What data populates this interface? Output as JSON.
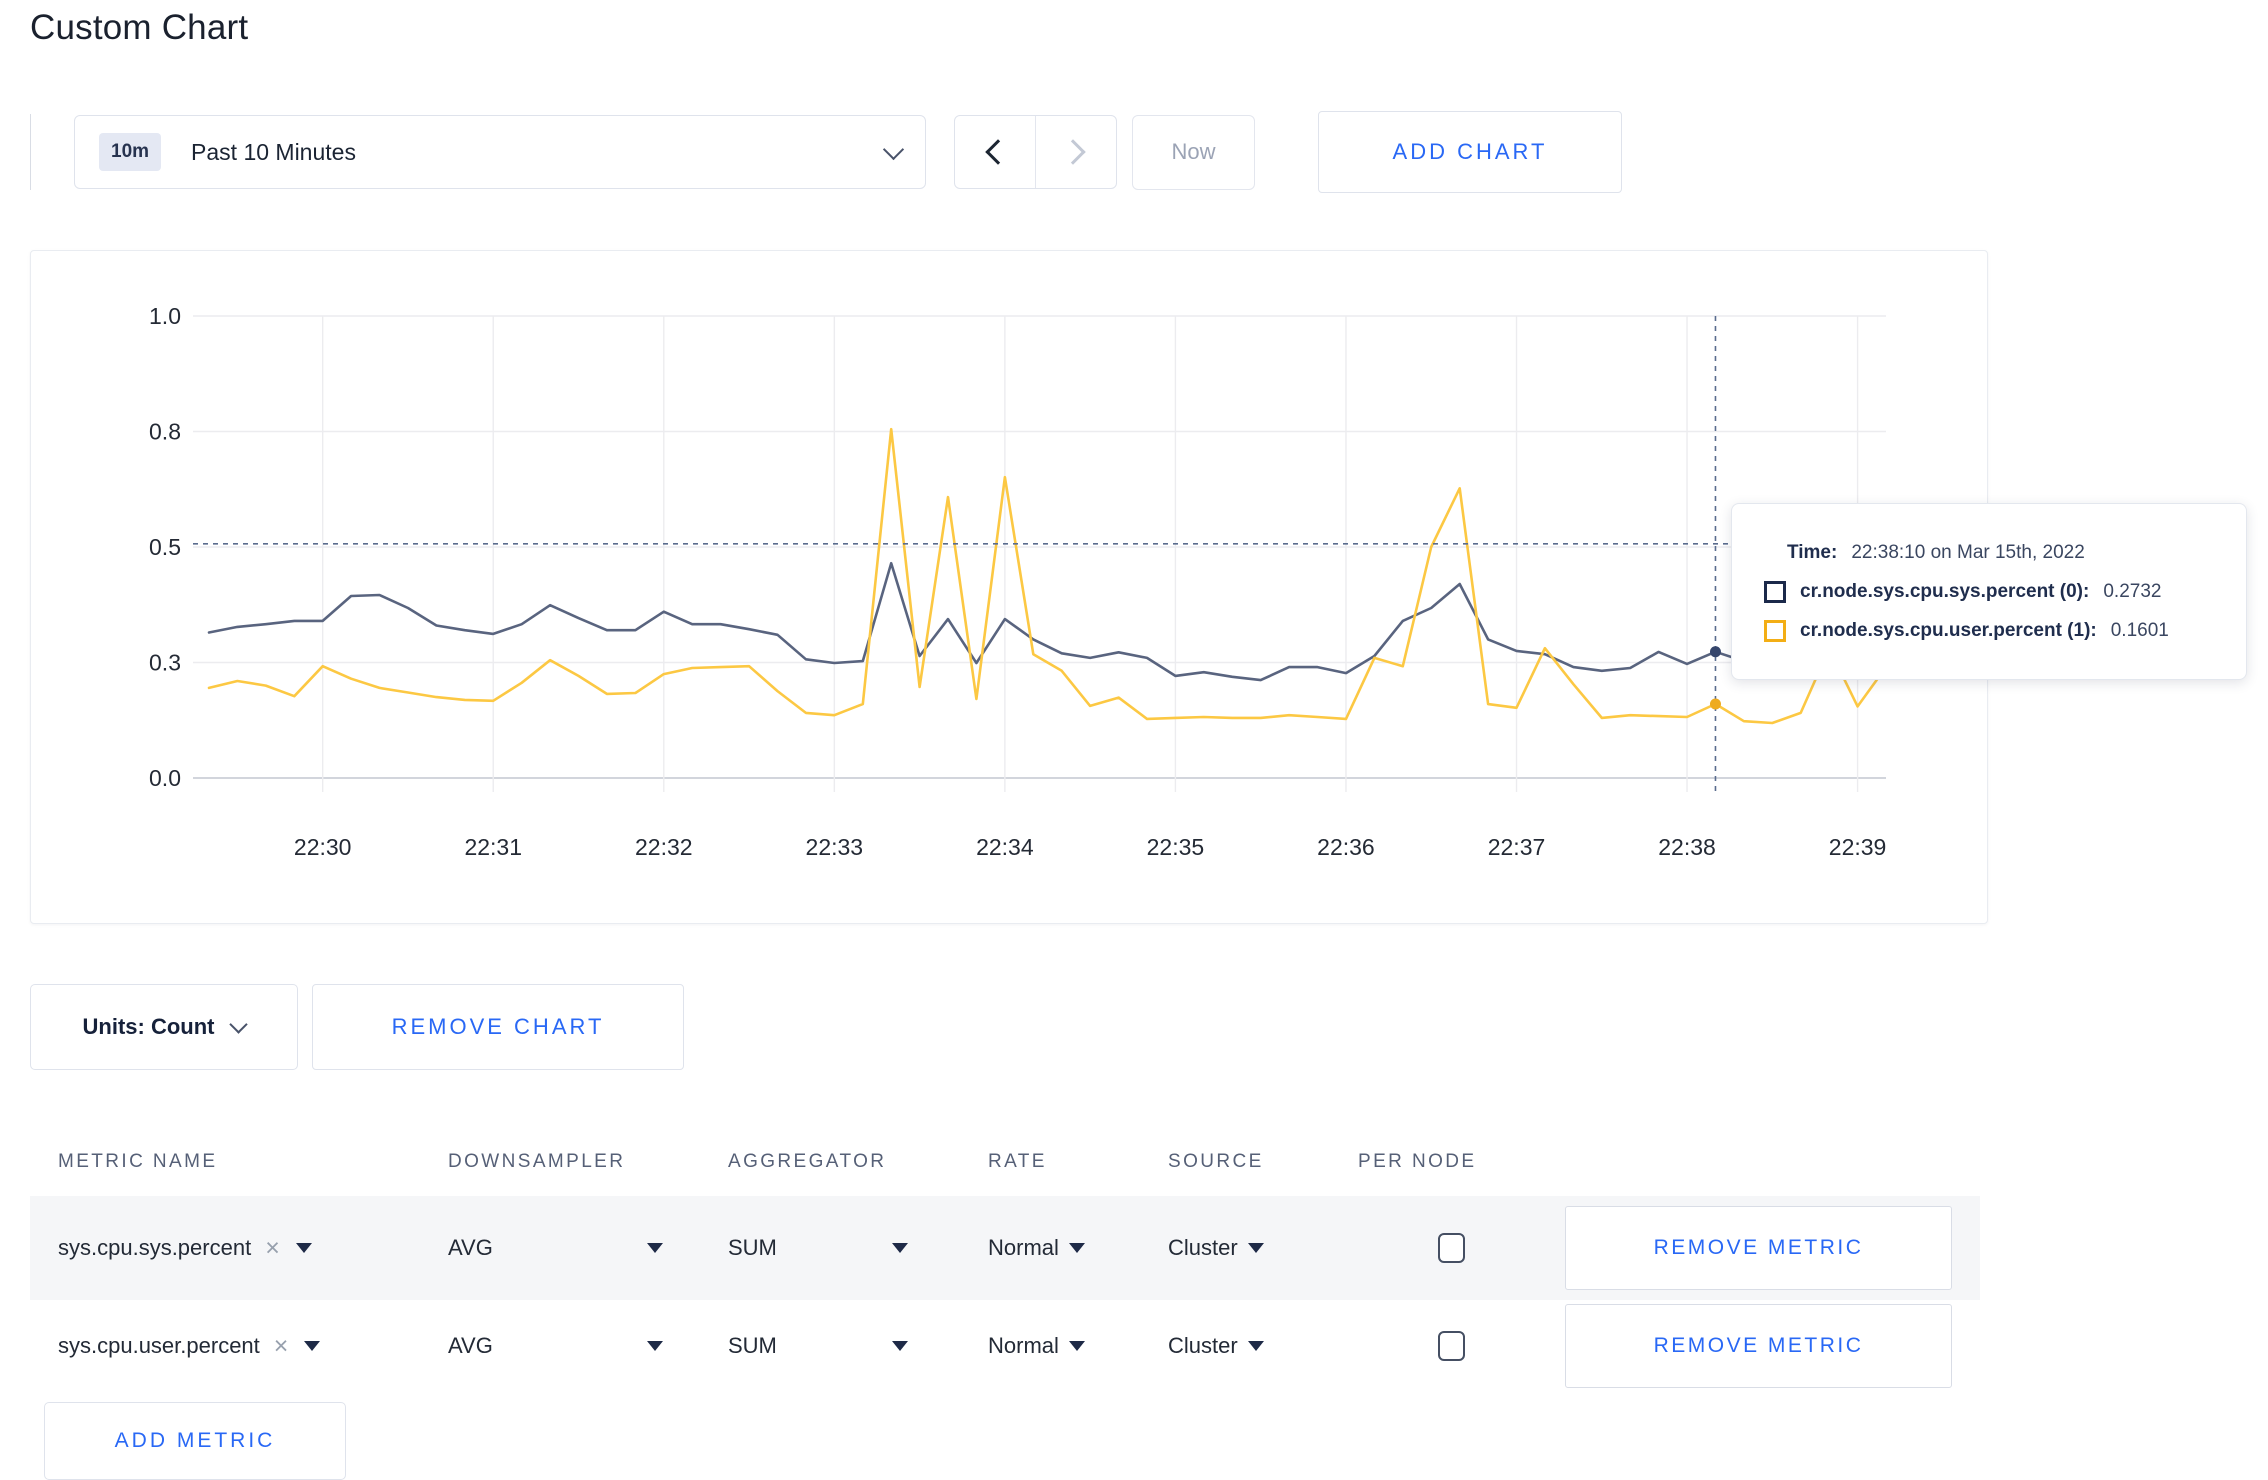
{
  "page": {
    "title": "Custom Chart"
  },
  "toolbar": {
    "time_range": {
      "badge": "10m",
      "label": "Past 10 Minutes"
    },
    "now_label": "Now",
    "add_chart_label": "ADD CHART"
  },
  "chart_data": {
    "type": "line",
    "x_ticks": [
      "22:30",
      "22:31",
      "22:32",
      "22:33",
      "22:34",
      "22:35",
      "22:36",
      "22:37",
      "22:38",
      "22:39"
    ],
    "y_tick_labels": [
      "0.0",
      "0.3",
      "0.5",
      "0.8",
      "1.0"
    ],
    "y_tick_values": [
      0,
      0.25,
      0.5,
      0.75,
      1.0
    ],
    "ylim": [
      0,
      1
    ],
    "start_time": "22:29:20",
    "interval_seconds": 10,
    "grid": true,
    "legend_position": "tooltip",
    "series": [
      {
        "name": "cr.node.sys.cpu.sys.percent",
        "color": "#59647f",
        "dot_color": "#36466c",
        "values": [
          0.315,
          0.327,
          0.333,
          0.34,
          0.34,
          0.394,
          0.396,
          0.368,
          0.33,
          0.32,
          0.312,
          0.333,
          0.374,
          0.346,
          0.32,
          0.32,
          0.36,
          0.333,
          0.333,
          0.322,
          0.31,
          0.257,
          0.249,
          0.253,
          0.465,
          0.264,
          0.344,
          0.249,
          0.344,
          0.3,
          0.27,
          0.26,
          0.272,
          0.26,
          0.221,
          0.229,
          0.219,
          0.212,
          0.24,
          0.24,
          0.227,
          0.264,
          0.34,
          0.368,
          0.42,
          0.3,
          0.275,
          0.268,
          0.24,
          0.232,
          0.238,
          0.273,
          0.247,
          0.2732,
          0.253,
          0.26,
          0.265,
          0.27,
          0.268,
          0.27
        ]
      },
      {
        "name": "cr.node.sys.cpu.user.percent",
        "color": "#fcc843",
        "dot_color": "#eeab1f",
        "values": [
          0.195,
          0.21,
          0.2,
          0.177,
          0.242,
          0.215,
          0.195,
          0.185,
          0.175,
          0.169,
          0.167,
          0.206,
          0.255,
          0.221,
          0.182,
          0.184,
          0.225,
          0.238,
          0.24,
          0.242,
          0.188,
          0.141,
          0.136,
          0.16,
          0.755,
          0.197,
          0.608,
          0.171,
          0.651,
          0.268,
          0.232,
          0.156,
          0.174,
          0.128,
          0.13,
          0.132,
          0.13,
          0.13,
          0.136,
          0.132,
          0.128,
          0.26,
          0.242,
          0.5,
          0.627,
          0.16,
          0.152,
          0.281,
          0.203,
          0.13,
          0.136,
          0.134,
          0.132,
          0.1601,
          0.123,
          0.119,
          0.141,
          0.28,
          0.155,
          0.24
        ]
      }
    ],
    "crosshair": {
      "index": 53,
      "time": "22:38:10",
      "h_value": 0.507
    }
  },
  "tooltip": {
    "time_label": "Time:",
    "time_value": "22:38:10 on Mar 15th, 2022",
    "series": [
      {
        "label": "cr.node.sys.cpu.sys.percent (0):",
        "value": "0.2732",
        "color": "#1b294a"
      },
      {
        "label": "cr.node.sys.cpu.user.percent (1):",
        "value": "0.1601",
        "color": "#f3ae15"
      }
    ]
  },
  "chart_footer": {
    "units_label": "Units: Count",
    "remove_chart_label": "REMOVE CHART"
  },
  "metrics_table": {
    "headers": [
      "METRIC NAME",
      "DOWNSAMPLER",
      "AGGREGATOR",
      "RATE",
      "SOURCE",
      "PER NODE"
    ],
    "rows": [
      {
        "metric": "sys.cpu.sys.percent",
        "close": "×",
        "downsampler": "AVG",
        "aggregator": "SUM",
        "rate": "Normal",
        "source": "Cluster",
        "per_node_checked": false,
        "remove_label": "REMOVE METRIC"
      },
      {
        "metric": "sys.cpu.user.percent",
        "close": "×",
        "downsampler": "AVG",
        "aggregator": "SUM",
        "rate": "Normal",
        "source": "Cluster",
        "per_node_checked": false,
        "remove_label": "REMOVE METRIC"
      }
    ],
    "add_metric_label": "ADD METRIC"
  },
  "colors": {
    "accent_blue": "#2968f5",
    "series_sys": "#59647f",
    "series_user": "#fcc843",
    "crosshair": "#5a6c8e"
  }
}
